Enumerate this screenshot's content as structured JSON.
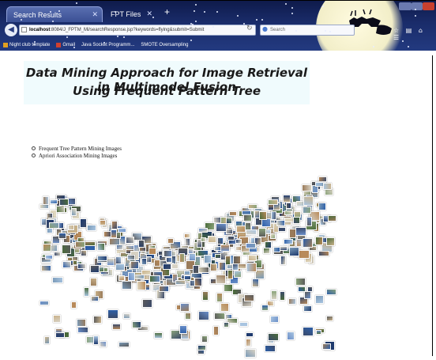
{
  "browser": {
    "tabs": [
      {
        "label": "Search Results"
      },
      {
        "label": "FPT Files"
      }
    ],
    "new_tab": "+",
    "url": {
      "host": "localhost",
      "rest": ":8084/J_FPTM_Mi/searchResponse.jsp?keywords=flying&submit=Submit"
    },
    "search_placeholder": "Search",
    "bookmarks": [
      {
        "label": "Night club template"
      },
      {
        "label": "Gmail"
      },
      {
        "label": "Java Socket Programm..."
      },
      {
        "label": "SMOTE Oversampling"
      }
    ]
  },
  "page": {
    "title_line1": "Data Mining Approach for Image Retrieval in Multimodel Fusion",
    "title_line2": "Using Frequent Pattern Tree",
    "options": [
      {
        "label": "Frequent Tree Pattern Mining Images"
      },
      {
        "label": "Apriori Association Mining Images"
      }
    ]
  },
  "colors": {
    "chrome_top": "#0e1a4a",
    "title_bg": "#f0fbfd",
    "close_button": "#c8402e"
  }
}
